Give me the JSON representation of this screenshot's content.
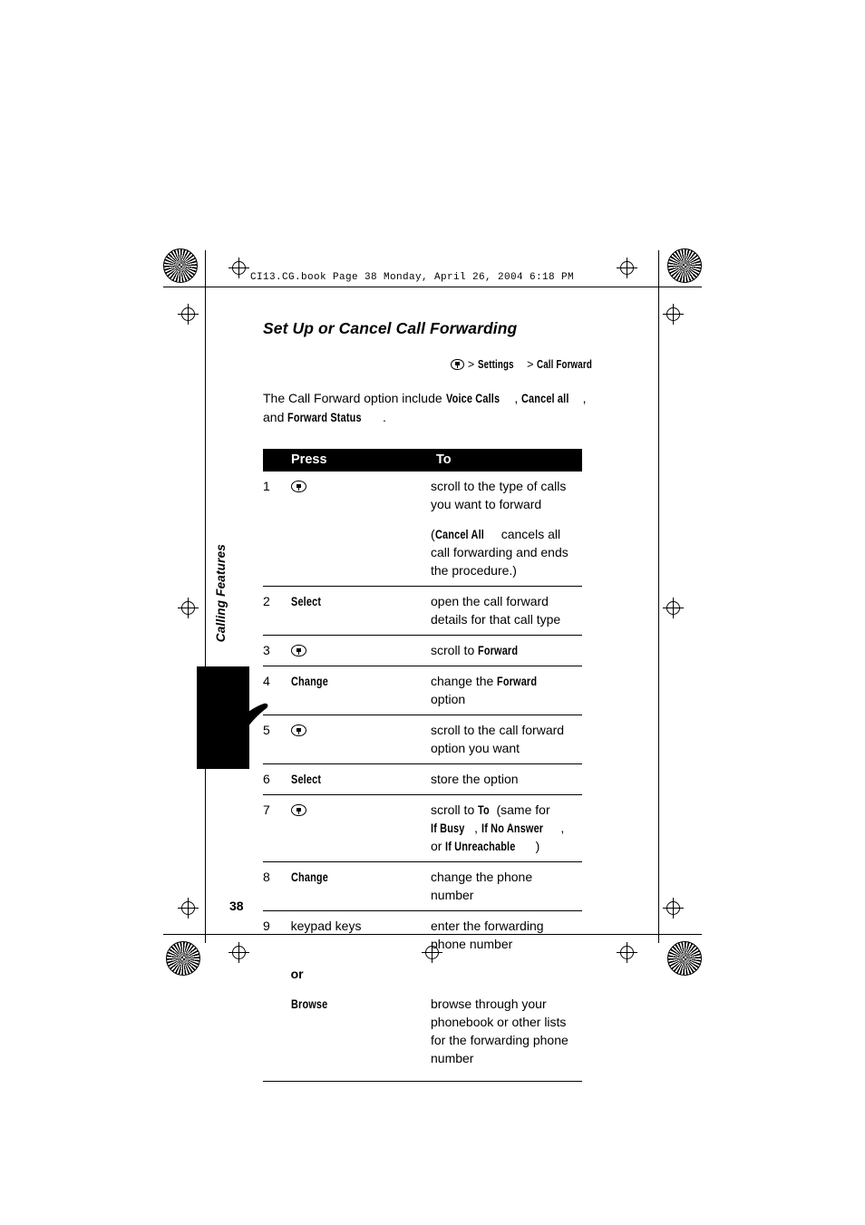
{
  "header": {
    "text": "CI13.CG.book  Page 38  Monday, April 26, 2004  6:18 PM"
  },
  "document": {
    "title": "Set Up or Cancel Call Forwarding",
    "page_number": "38",
    "side_tab_label": "Calling Features",
    "breadcrumb": {
      "menu_icon": "menu-icon",
      "sep1": ">",
      "item1": "Settings",
      "sep2": ">",
      "item2": "Call Forward"
    },
    "intro": {
      "part1": "The Call Forward option include ",
      "bold1": "Voice Calls",
      "part2": ", ",
      "bold2": "Cancel all",
      "part3": ", and ",
      "bold3": "Forward Status",
      "part4": "."
    },
    "table": {
      "headers": {
        "press": "Press",
        "to": "To"
      },
      "rows": [
        {
          "num": "1",
          "press_icon": "nav-icon",
          "press": "",
          "to_plain": "scroll to the type of calls you want to forward",
          "sub": {
            "lead": "(",
            "bold": "Cancel All",
            "tail": " cancels all call forwarding and ends the procedure.)"
          }
        },
        {
          "num": "2",
          "press": "Select",
          "to_plain": "open the call forward details for that call type"
        },
        {
          "num": "3",
          "press_icon": "nav-icon",
          "press": "",
          "to_lead": "scroll to ",
          "to_bold": "Forward"
        },
        {
          "num": "4",
          "press": "Change",
          "to_lead": "change the ",
          "to_bold": "Forward",
          "to_tail": " option"
        },
        {
          "num": "5",
          "press_icon": "nav-icon",
          "press": "",
          "to_plain": "scroll to the call forward option you want"
        },
        {
          "num": "6",
          "press": "Select",
          "to_plain": "store the option"
        },
        {
          "num": "7",
          "press_icon": "nav-icon",
          "press": "",
          "to_seq": [
            {
              "t": "scroll to ",
              "b": false
            },
            {
              "t": "To",
              "b": true
            },
            {
              "t": " (same for ",
              "b": false
            },
            {
              "t": "If Busy",
              "b": true
            },
            {
              "t": ", ",
              "b": false
            },
            {
              "t": "If No Answer",
              "b": true
            },
            {
              "t": ", or ",
              "b": false
            },
            {
              "t": "If Unreachable",
              "b": true
            },
            {
              "t": ")",
              "b": false
            }
          ]
        },
        {
          "num": "8",
          "press": "Change",
          "to_plain": "change the phone number"
        },
        {
          "num": "9",
          "press_plain": "keypad keys",
          "to_plain": "enter the forwarding phone number"
        },
        {
          "num": "",
          "or": "or"
        },
        {
          "num": "",
          "press": "Browse",
          "to_plain": "browse through your phonebook or other lists for the forwarding phone number"
        }
      ]
    }
  }
}
